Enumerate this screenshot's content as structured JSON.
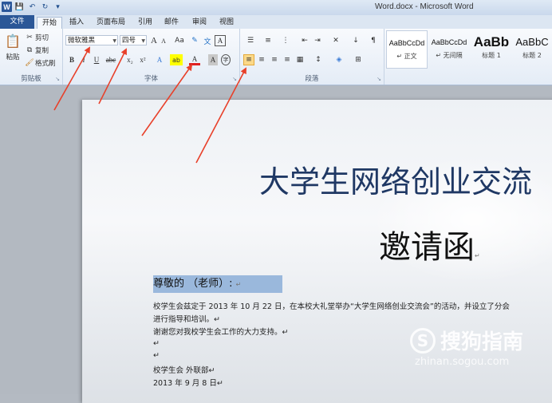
{
  "window": {
    "title": "Word.docx - Microsoft Word"
  },
  "qat": {
    "logo": "W",
    "save": "💾",
    "undo": "↶",
    "redo": "↻",
    "more": "▾"
  },
  "tabs": [
    "文件",
    "开始",
    "插入",
    "页面布局",
    "引用",
    "邮件",
    "审阅",
    "视图"
  ],
  "clipboard": {
    "paste": "粘贴",
    "cut": "剪切",
    "copy": "复制",
    "format_painter": "格式刷",
    "label": "剪贴板"
  },
  "font": {
    "name": "微软雅黑",
    "size": "四号",
    "label": "字体"
  },
  "paragraph": {
    "label": "段落"
  },
  "styles": [
    {
      "preview": "AaBbCcDd",
      "name": "↵ 正文"
    },
    {
      "preview": "AaBbCcDd",
      "name": "↵ 无间隔"
    },
    {
      "preview": "AaBb",
      "name": "标题 1"
    },
    {
      "preview": "AaBbC",
      "name": "标题 2"
    }
  ],
  "document": {
    "title": "大学生网络创业交流",
    "subtitle": "邀请函",
    "greeting": "尊敬的         （老师）:",
    "lines": [
      "校学生会兹定于 2013 年 10 月 22 日，在本校大礼堂举办“大学生网络创业交流会”的活动，并设立了分会",
      "进行指导和培训。↵",
      "谢谢您对我校学生会工作的大力支持。↵",
      "↵",
      "↵",
      "校学生会 外联部↵",
      "2013 年 9 月 8 日↵"
    ],
    "para_mark": "↵"
  },
  "watermark": {
    "icon": "S",
    "text": "搜狗指南",
    "url": "zhinan.sogou.com"
  },
  "colors": {
    "accent": "#2b579a",
    "arrow": "#e8402a",
    "title": "#1f3864",
    "highlight": "#9ab8dc"
  }
}
